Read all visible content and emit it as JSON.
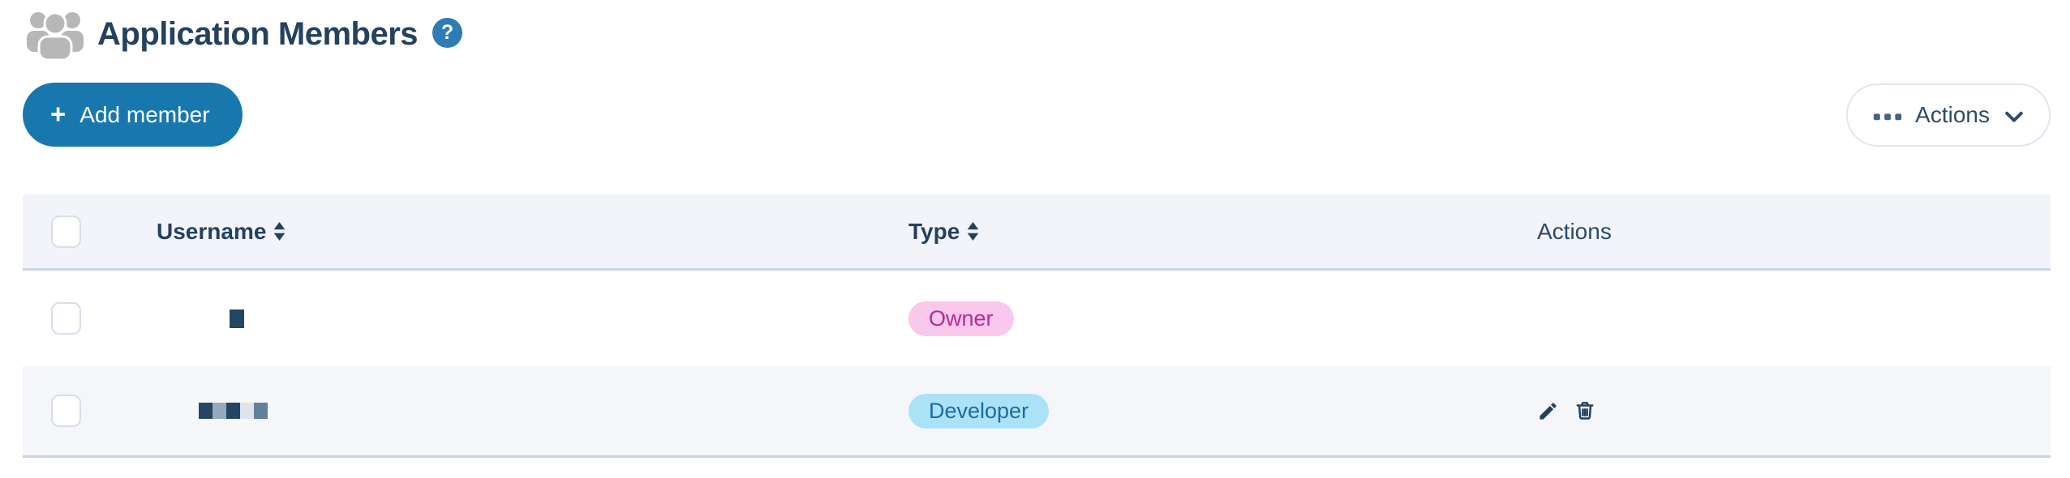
{
  "header": {
    "title": "Application Members",
    "help_glyph": "?"
  },
  "toolbar": {
    "add_member": {
      "icon_glyph": "+",
      "label": "Add member"
    },
    "actions_menu": {
      "label": "Actions"
    }
  },
  "table": {
    "columns": [
      {
        "label": "Username",
        "sortable": true
      },
      {
        "label": "Type",
        "sortable": true
      },
      {
        "label": "Actions",
        "sortable": false
      }
    ],
    "rows": [
      {
        "username": "",
        "username_redacted": true,
        "redaction_blocks": [
          "#254564"
        ],
        "type": {
          "label": "Owner",
          "badge_bg": "#f9c8ec",
          "badge_text": "#b82a94"
        },
        "row_actions": []
      },
      {
        "username": "",
        "username_redacted": true,
        "redaction_blocks": [
          "#254564",
          "#97a9bd",
          "#254564",
          "#dfe4ec",
          "#637f9b"
        ],
        "type": {
          "label": "Developer",
          "badge_bg": "#ace2f7",
          "badge_text": "#1b6ba2"
        },
        "row_actions": [
          "edit",
          "delete"
        ]
      }
    ]
  },
  "colors": {
    "accent_blue": "#1878ad",
    "title_navy": "#24415e",
    "help_icon_blue": "#2d7cb5",
    "table_header_bg": "#f2f4f9",
    "row_alt_bg": "#f4f6fa",
    "divider": "#cdd4e7",
    "icon_gray": "#b7b7b7"
  }
}
